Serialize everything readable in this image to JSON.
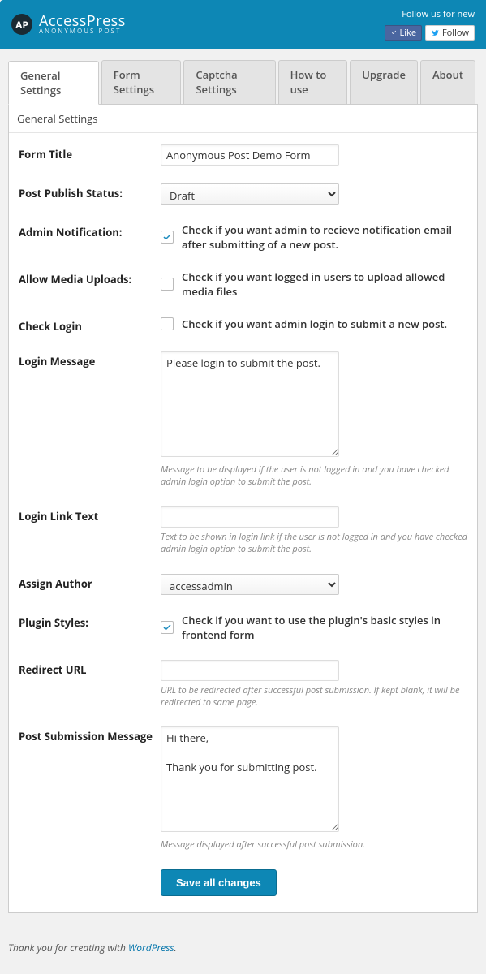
{
  "header": {
    "logo_badge": "AP",
    "logo_main": "AccessPress",
    "logo_sub": "ANONYMOUS POST",
    "follow_text": "Follow us for new",
    "like_label": "Like",
    "follow_label": "Follow"
  },
  "tabs": {
    "general": "General Settings",
    "form": "Form Settings",
    "captcha": "Captcha Settings",
    "howto": "How to use",
    "upgrade": "Upgrade",
    "about": "About"
  },
  "panel": {
    "title": "General Settings"
  },
  "fields": {
    "form_title": {
      "label": "Form Title",
      "value": "Anonymous Post Demo Form"
    },
    "publish_status": {
      "label": "Post Publish Status:",
      "value": "Draft"
    },
    "admin_notif": {
      "label": "Admin Notification:",
      "checked": true,
      "text": "Check if you want admin to recieve notification email after submitting of a new post."
    },
    "media_uploads": {
      "label": "Allow Media Uploads:",
      "checked": false,
      "text": "Check if you want logged in users to upload allowed media files"
    },
    "check_login": {
      "label": "Check Login",
      "checked": false,
      "text": "Check if you want admin login to submit a new post."
    },
    "login_message": {
      "label": "Login Message",
      "value": "Please login to submit the post.",
      "hint": "Message to be displayed if the user is not logged in and you have checked admin login option to submit the post."
    },
    "login_link_text": {
      "label": "Login Link Text",
      "value": "",
      "hint": "Text to be shown in login link if the user is not logged in and you have checked admin login option to submit the post."
    },
    "assign_author": {
      "label": "Assign Author",
      "value": "accessadmin"
    },
    "plugin_styles": {
      "label": "Plugin Styles:",
      "checked": true,
      "text": "Check if you want to use the plugin's basic styles in frontend form"
    },
    "redirect_url": {
      "label": "Redirect URL",
      "value": "",
      "hint": "URL to be redirected after successful post submission. If kept blank, it will be redirected to same page."
    },
    "post_submission": {
      "label": "Post Submission Message",
      "value": "Hi there,\n\nThank you for submitting post.",
      "hint": "Message displayed after successful post submission."
    }
  },
  "save_label": "Save all changes",
  "footer": {
    "prefix": "Thank you for creating with ",
    "link": "WordPress",
    "suffix": "."
  }
}
